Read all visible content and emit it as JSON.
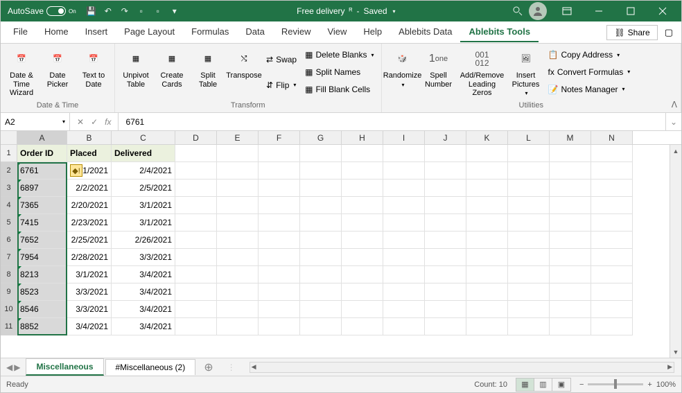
{
  "title_bar": {
    "autosave_label": "AutoSave",
    "autosave_state": "On",
    "doc_name": "Free delivery",
    "save_state": "Saved"
  },
  "tabs": [
    "File",
    "Home",
    "Insert",
    "Page Layout",
    "Formulas",
    "Data",
    "Review",
    "View",
    "Help",
    "Ablebits Data",
    "Ablebits Tools"
  ],
  "active_tab": "Ablebits Tools",
  "share_label": "Share",
  "ribbon": {
    "datetime": {
      "b1": "Date &\nTime Wizard",
      "b2": "Date\nPicker",
      "b3": "Text to\nDate",
      "label": "Date & Time"
    },
    "transform": {
      "b1": "Unpivot\nTable",
      "b2": "Create\nCards",
      "b3": "Split\nTable",
      "b4": "Transpose",
      "s1": "Swap",
      "s2": "Flip",
      "d1": "Delete Blanks",
      "d2": "Split Names",
      "d3": "Fill Blank Cells",
      "label": "Transform"
    },
    "utilities": {
      "b1": "Randomize",
      "b2": "Spell\nNumber",
      "b3": "Add/Remove\nLeading Zeros",
      "b4": "Insert\nPictures",
      "s1": "Copy Address",
      "s2": "Convert Formulas",
      "s3": "Notes Manager",
      "label": "Utilities",
      "one": "one"
    }
  },
  "formula_bar": {
    "name": "A2",
    "fx": "fx",
    "value": "6761"
  },
  "columns": [
    "A",
    "B",
    "C",
    "D",
    "E",
    "F",
    "G",
    "H",
    "I",
    "J",
    "K",
    "L",
    "M",
    "N"
  ],
  "headers": {
    "A": "Order ID",
    "B": "Placed",
    "C": "Delivered"
  },
  "rows": [
    {
      "n": 1
    },
    {
      "n": 2,
      "A": "6761",
      "B": "2/1/2021",
      "C": "2/4/2021",
      "first_sel": true
    },
    {
      "n": 3,
      "A": "6897",
      "B": "2/2/2021",
      "C": "2/5/2021"
    },
    {
      "n": 4,
      "A": "7365",
      "B": "2/20/2021",
      "C": "3/1/2021"
    },
    {
      "n": 5,
      "A": "7415",
      "B": "2/23/2021",
      "C": "3/1/2021"
    },
    {
      "n": 6,
      "A": "7652",
      "B": "2/25/2021",
      "C": "2/26/2021"
    },
    {
      "n": 7,
      "A": "7954",
      "B": "2/28/2021",
      "C": "3/3/2021"
    },
    {
      "n": 8,
      "A": "8213",
      "B": "3/1/2021",
      "C": "3/4/2021"
    },
    {
      "n": 9,
      "A": "8523",
      "B": "3/3/2021",
      "C": "3/4/2021"
    },
    {
      "n": 10,
      "A": "8546",
      "B": "3/3/2021",
      "C": "3/4/2021"
    },
    {
      "n": 11,
      "A": "8852",
      "B": "3/4/2021",
      "C": "3/4/2021"
    }
  ],
  "sheet_tabs": {
    "active": "Miscellaneous",
    "other": "#Miscellaneous (2)"
  },
  "status": {
    "ready": "Ready",
    "count": "Count: 10",
    "zoom": "100%"
  }
}
